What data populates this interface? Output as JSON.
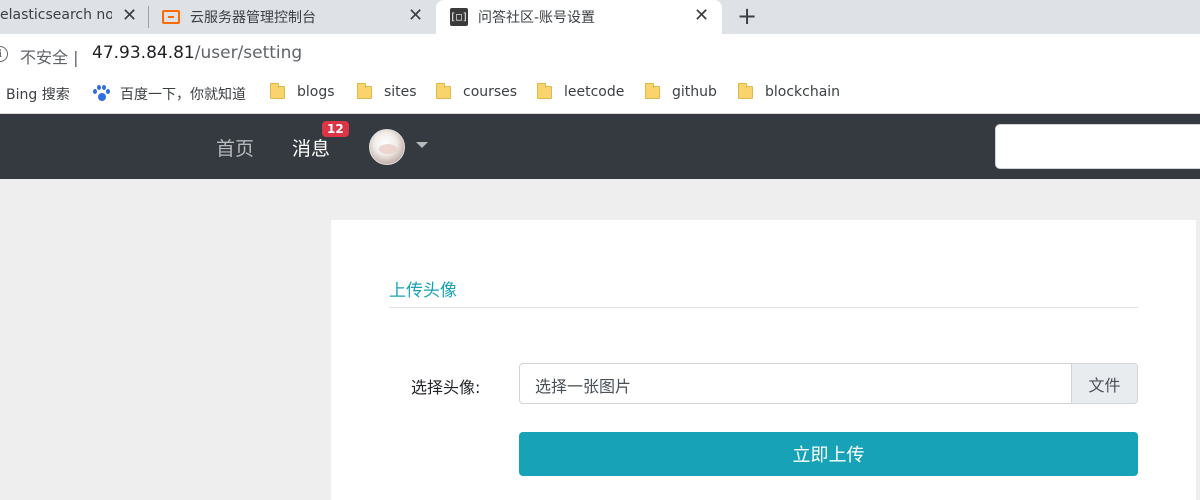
{
  "browser": {
    "tabs": [
      {
        "title": "elasticsearch noc",
        "favicon": "none"
      },
      {
        "title": "云服务器管理控制台",
        "favicon": "aliyun-icon"
      },
      {
        "title": "问答社区-账号设置",
        "favicon": "wenda-icon"
      }
    ],
    "tab_close": "✕",
    "new_tab": "+",
    "address": {
      "security": "不安全",
      "separator": "|",
      "host": "47.93.84.81",
      "path": "/user/setting"
    },
    "bookmarks": [
      {
        "label": "Bing 搜索"
      },
      {
        "label": "百度一下，你就知道"
      },
      {
        "label": "blogs"
      },
      {
        "label": "sites"
      },
      {
        "label": "courses"
      },
      {
        "label": "leetcode"
      },
      {
        "label": "github"
      },
      {
        "label": "blockchain"
      }
    ]
  },
  "navbar": {
    "home": "首页",
    "messages": "消息",
    "message_count": "12",
    "colors": {
      "bg": "#343a40",
      "badge": "#dc3545"
    }
  },
  "settings": {
    "section_title": "上传头像",
    "field_label": "选择头像:",
    "file_placeholder": "选择一张图片",
    "file_button": "文件",
    "upload_button": "立即上传",
    "colors": {
      "accent": "#17a2b8"
    }
  }
}
